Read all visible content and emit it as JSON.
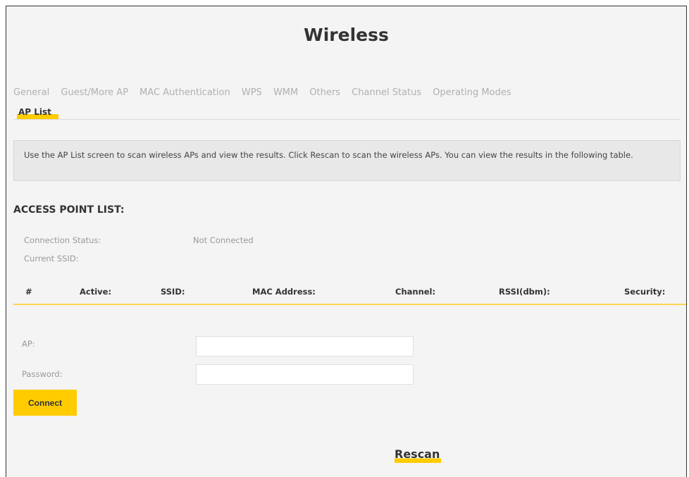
{
  "page": {
    "title": "Wireless"
  },
  "tabs": {
    "items": [
      {
        "label": "General"
      },
      {
        "label": "Guest/More AP"
      },
      {
        "label": "MAC Authentication"
      },
      {
        "label": "WPS"
      },
      {
        "label": "WMM"
      },
      {
        "label": "Others"
      },
      {
        "label": "Channel Status"
      },
      {
        "label": "Operating Modes"
      }
    ],
    "active": {
      "label": "AP List"
    }
  },
  "info": {
    "text": "Use the AP List screen to scan wireless APs and view the results. Click Rescan to scan the wireless APs. You can view the results in the following table."
  },
  "section": {
    "title": "ACCESS POINT LIST:"
  },
  "status": {
    "connection_label": "Connection Status:",
    "connection_value": "Not Connected",
    "ssid_label": "Current SSID:",
    "ssid_value": ""
  },
  "table": {
    "headers": [
      "#",
      "Active:",
      "SSID:",
      "MAC Address:",
      "Channel:",
      "RSSI(dbm):",
      "Security:"
    ],
    "rows": []
  },
  "form": {
    "ap_label": "AP:",
    "ap_value": "",
    "password_label": "Password:",
    "password_value": "",
    "connect_label": "Connect"
  },
  "actions": {
    "rescan_label": "Rescan"
  },
  "colors": {
    "accent": "#ffcc00",
    "background": "#f4f4f4",
    "info_box": "#e8e8e8"
  }
}
